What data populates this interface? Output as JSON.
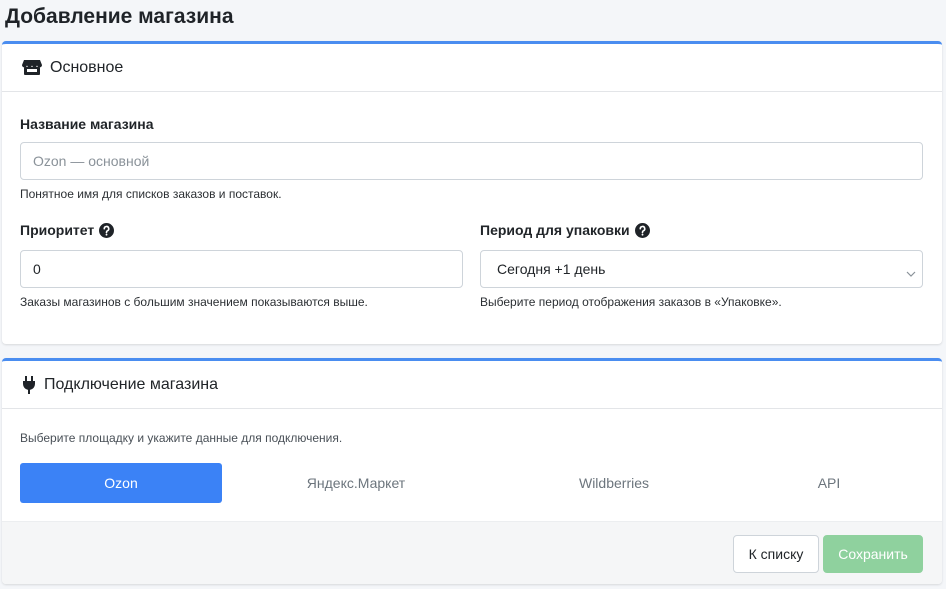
{
  "page": {
    "title": "Добавление магазина"
  },
  "basic": {
    "header_title": "Основное",
    "header_icon": "store-icon",
    "name_label": "Название магазина",
    "name_placeholder": "Ozon — основной",
    "name_help": "Понятное имя для списков заказов и поставок.",
    "priority_label": "Приоритет",
    "priority_value": "0",
    "priority_help": "Заказы магазинов с большим значением показываются выше.",
    "period_label": "Период для упаковки",
    "period_selected": "Сегодня +1 день",
    "period_help": "Выберите период отображения заказов в «Упаковке».",
    "help_icon": "question-circle-icon"
  },
  "connect": {
    "header_title": "Подключение магазина",
    "header_icon": "plug-icon",
    "intro": "Выберите площадку и укажите данные для подключения.",
    "tabs": [
      {
        "label": "Ozon",
        "active": true
      },
      {
        "label": "Яндекс.Маркет",
        "active": false
      },
      {
        "label": "Wildberries",
        "active": false
      },
      {
        "label": "API",
        "active": false
      }
    ]
  },
  "footer": {
    "back_label": "К списку",
    "save_label": "Сохранить"
  },
  "colors": {
    "accent": "#3b82f6",
    "card_top_border": "#4a8df0",
    "save_button": "#8fd19e"
  }
}
